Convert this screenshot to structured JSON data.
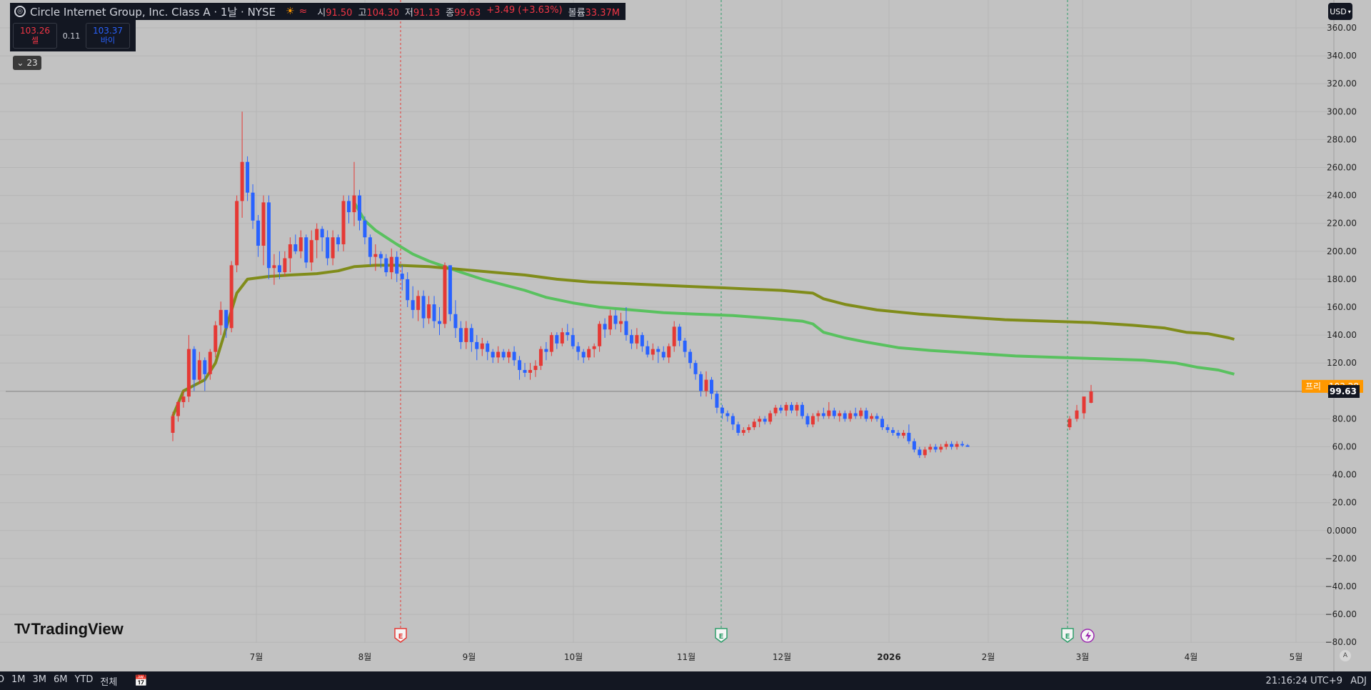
{
  "header": {
    "title": "Circle Internet Group, Inc. Class A · 1날 · NYSE",
    "logo_icon": "circle-logo-icon",
    "ohlc": {
      "open_label": "시",
      "open": "91.50",
      "high_label": "고",
      "high": "104.30",
      "low_label": "저",
      "low": "91.13",
      "close_label": "종",
      "close": "99.63",
      "change": "+3.49 (+3.63%)",
      "volume_label": "볼륨",
      "volume": "33.37M"
    }
  },
  "trade": {
    "sell_price": "103.26",
    "sell_label": "셀",
    "spread": "0.11",
    "buy_price": "103.37",
    "buy_label": "바이"
  },
  "indicators_toggle": {
    "count": "23"
  },
  "currency": "USD",
  "brand": "TradingView",
  "bottom_bar": {
    "ranges": [
      "D",
      "1M",
      "3M",
      "6M",
      "YTD",
      "전체"
    ],
    "clock": "21:16:24 UTC+9",
    "adj": "ADJ"
  },
  "auto_scale_label": "A",
  "colors": {
    "up": "#e53935",
    "down": "#2962ff",
    "ma_fast": "#59c15f",
    "ma_slow": "#808c1a",
    "background": "#c2c2c2",
    "price_tag_orange": "#ff9800"
  },
  "chart_data": {
    "type": "candlestick",
    "symbol": "Circle Internet Group, Inc. Class A",
    "interval": "1날",
    "exchange": "NYSE",
    "y_axis_ticks": [
      "360.00",
      "340.00",
      "320.00",
      "300.00",
      "280.00",
      "260.00",
      "240.00",
      "220.00",
      "200.00",
      "180.00",
      "160.00",
      "140.00",
      "120.00",
      "100.00",
      "80.00",
      "60.00",
      "40.00",
      "20.00",
      "0.0000",
      "−20.00",
      "−40.00",
      "−60.00",
      "−80.00"
    ],
    "ylim": [
      -80,
      360
    ],
    "x_axis_labels": [
      "7월",
      "8월",
      "9월",
      "10월",
      "11월",
      "12월",
      "2026",
      "2월",
      "3월",
      "4월",
      "5월"
    ],
    "last_price": "99.63",
    "pre_market": {
      "label": "프리",
      "price": "103.28"
    },
    "earnings_markers": [
      "E",
      "E",
      "E"
    ],
    "candles": [
      [
        70,
        85,
        64,
        82
      ],
      [
        82,
        93,
        78,
        92
      ],
      [
        92,
        100,
        88,
        96
      ],
      [
        96,
        140,
        92,
        130
      ],
      [
        130,
        132,
        100,
        108
      ],
      [
        108,
        128,
        105,
        122
      ],
      [
        122,
        124,
        100,
        112
      ],
      [
        112,
        130,
        108,
        128
      ],
      [
        128,
        150,
        124,
        147
      ],
      [
        147,
        164,
        140,
        158
      ],
      [
        158,
        158,
        138,
        145
      ],
      [
        145,
        193,
        142,
        190
      ],
      [
        190,
        240,
        185,
        236
      ],
      [
        236,
        300,
        224,
        264
      ],
      [
        264,
        268,
        236,
        242
      ],
      [
        242,
        248,
        216,
        222
      ],
      [
        222,
        226,
        196,
        204
      ],
      [
        204,
        240,
        190,
        235
      ],
      [
        235,
        240,
        180,
        188
      ],
      [
        188,
        198,
        176,
        190
      ],
      [
        190,
        200,
        180,
        185
      ],
      [
        185,
        200,
        182,
        195
      ],
      [
        195,
        210,
        185,
        205
      ],
      [
        205,
        212,
        198,
        200
      ],
      [
        200,
        215,
        195,
        210
      ],
      [
        210,
        212,
        188,
        192
      ],
      [
        192,
        215,
        186,
        208
      ],
      [
        208,
        220,
        195,
        216
      ],
      [
        216,
        218,
        200,
        210
      ],
      [
        210,
        215,
        190,
        195
      ],
      [
        195,
        215,
        190,
        210
      ],
      [
        210,
        212,
        200,
        205
      ],
      [
        205,
        240,
        200,
        236
      ],
      [
        236,
        240,
        220,
        228
      ],
      [
        228,
        264,
        218,
        240
      ],
      [
        240,
        244,
        215,
        222
      ],
      [
        222,
        225,
        205,
        210
      ],
      [
        210,
        212,
        190,
        196
      ],
      [
        196,
        205,
        186,
        198
      ],
      [
        198,
        200,
        188,
        195
      ],
      [
        195,
        198,
        182,
        185
      ],
      [
        185,
        202,
        180,
        196
      ],
      [
        196,
        200,
        178,
        184
      ],
      [
        184,
        190,
        172,
        180
      ],
      [
        180,
        185,
        160,
        165
      ],
      [
        165,
        175,
        152,
        158
      ],
      [
        158,
        172,
        150,
        168
      ],
      [
        168,
        172,
        145,
        152
      ],
      [
        152,
        168,
        148,
        162
      ],
      [
        162,
        168,
        145,
        150
      ],
      [
        150,
        160,
        140,
        148
      ],
      [
        148,
        192,
        145,
        190
      ],
      [
        190,
        190,
        150,
        155
      ],
      [
        155,
        165,
        138,
        145
      ],
      [
        145,
        150,
        130,
        135
      ],
      [
        135,
        150,
        130,
        145
      ],
      [
        145,
        148,
        128,
        135
      ],
      [
        135,
        140,
        122,
        130
      ],
      [
        130,
        138,
        125,
        134
      ],
      [
        134,
        136,
        122,
        128
      ],
      [
        128,
        130,
        120,
        124
      ],
      [
        124,
        132,
        120,
        128
      ],
      [
        128,
        130,
        122,
        124
      ],
      [
        124,
        130,
        120,
        128
      ],
      [
        128,
        132,
        118,
        122
      ],
      [
        122,
        125,
        108,
        115
      ],
      [
        115,
        120,
        110,
        113
      ],
      [
        113,
        120,
        108,
        115
      ],
      [
        115,
        122,
        110,
        118
      ],
      [
        118,
        132,
        115,
        130
      ],
      [
        130,
        135,
        122,
        128
      ],
      [
        128,
        142,
        125,
        140
      ],
      [
        140,
        142,
        130,
        134
      ],
      [
        134,
        145,
        132,
        142
      ],
      [
        142,
        148,
        136,
        140
      ],
      [
        140,
        145,
        130,
        132
      ],
      [
        132,
        135,
        122,
        128
      ],
      [
        128,
        130,
        120,
        124
      ],
      [
        124,
        132,
        122,
        130
      ],
      [
        130,
        134,
        124,
        132
      ],
      [
        132,
        150,
        128,
        148
      ],
      [
        148,
        152,
        138,
        144
      ],
      [
        144,
        158,
        140,
        154
      ],
      [
        154,
        158,
        144,
        148
      ],
      [
        148,
        156,
        142,
        150
      ],
      [
        150,
        160,
        136,
        140
      ],
      [
        140,
        144,
        130,
        134
      ],
      [
        134,
        145,
        130,
        140
      ],
      [
        140,
        142,
        128,
        132
      ],
      [
        132,
        136,
        124,
        126
      ],
      [
        126,
        134,
        122,
        130
      ],
      [
        130,
        132,
        120,
        128
      ],
      [
        128,
        132,
        122,
        124
      ],
      [
        124,
        134,
        120,
        132
      ],
      [
        132,
        150,
        128,
        146
      ],
      [
        146,
        148,
        132,
        136
      ],
      [
        136,
        138,
        124,
        128
      ],
      [
        128,
        130,
        116,
        120
      ],
      [
        120,
        122,
        108,
        112
      ],
      [
        112,
        114,
        96,
        100
      ],
      [
        100,
        114,
        96,
        108
      ],
      [
        108,
        110,
        94,
        98
      ],
      [
        98,
        100,
        84,
        88
      ],
      [
        88,
        90,
        80,
        84
      ],
      [
        84,
        86,
        78,
        82
      ],
      [
        82,
        84,
        72,
        76
      ],
      [
        76,
        78,
        68,
        70
      ],
      [
        70,
        74,
        68,
        72
      ],
      [
        72,
        76,
        70,
        74
      ],
      [
        74,
        80,
        72,
        78
      ],
      [
        78,
        82,
        74,
        80
      ],
      [
        80,
        82,
        76,
        78
      ],
      [
        78,
        86,
        76,
        84
      ],
      [
        84,
        90,
        82,
        88
      ],
      [
        88,
        90,
        84,
        86
      ],
      [
        86,
        92,
        82,
        90
      ],
      [
        90,
        92,
        84,
        86
      ],
      [
        86,
        92,
        82,
        90
      ],
      [
        90,
        92,
        80,
        82
      ],
      [
        82,
        84,
        74,
        76
      ],
      [
        76,
        84,
        74,
        82
      ],
      [
        82,
        86,
        78,
        84
      ],
      [
        84,
        88,
        80,
        82
      ],
      [
        82,
        92,
        80,
        86
      ],
      [
        86,
        88,
        80,
        82
      ],
      [
        82,
        86,
        78,
        84
      ],
      [
        84,
        86,
        78,
        80
      ],
      [
        80,
        86,
        78,
        84
      ],
      [
        84,
        88,
        80,
        82
      ],
      [
        82,
        88,
        80,
        86
      ],
      [
        86,
        88,
        78,
        80
      ],
      [
        80,
        84,
        78,
        82
      ],
      [
        82,
        84,
        78,
        80
      ],
      [
        80,
        82,
        72,
        74
      ],
      [
        74,
        76,
        70,
        72
      ],
      [
        72,
        74,
        68,
        70
      ],
      [
        70,
        72,
        66,
        68
      ],
      [
        68,
        72,
        66,
        70
      ],
      [
        70,
        76,
        62,
        64
      ],
      [
        64,
        66,
        56,
        58
      ],
      [
        58,
        60,
        52,
        54
      ],
      [
        54,
        60,
        52,
        58
      ],
      [
        58,
        62,
        56,
        60
      ],
      [
        60,
        62,
        56,
        58
      ],
      [
        58,
        62,
        56,
        60
      ],
      [
        60,
        64,
        58,
        62
      ],
      [
        62,
        64,
        58,
        60
      ],
      [
        60,
        64,
        58,
        62
      ],
      [
        62,
        64,
        60,
        61
      ],
      [
        61,
        62,
        60,
        60
      ],
      [
        74,
        82,
        72,
        80
      ],
      [
        80,
        90,
        78,
        86
      ],
      [
        84,
        92,
        80,
        96
      ],
      [
        91.5,
        104.3,
        91.13,
        99.63
      ]
    ],
    "series": [
      {
        "name": "",
        "color": "#59c15f",
        "points": [
          [
            34,
            235
          ],
          [
            36,
            222
          ],
          [
            38,
            215
          ],
          [
            40,
            210
          ],
          [
            42,
            205
          ],
          [
            45,
            198
          ],
          [
            48,
            193
          ],
          [
            51,
            189
          ],
          [
            54,
            185
          ],
          [
            58,
            180
          ],
          [
            62,
            176
          ],
          [
            66,
            172
          ],
          [
            70,
            167
          ],
          [
            75,
            163
          ],
          [
            80,
            160
          ],
          [
            86,
            158
          ],
          [
            92,
            156
          ],
          [
            98,
            155
          ],
          [
            105,
            154
          ],
          [
            112,
            152
          ],
          [
            118,
            150
          ],
          [
            120,
            148
          ],
          [
            122,
            142
          ],
          [
            126,
            138
          ],
          [
            130,
            135
          ],
          [
            136,
            131
          ],
          [
            142,
            129
          ],
          [
            150,
            127
          ],
          [
            158,
            125
          ],
          [
            166,
            124
          ],
          [
            174,
            123
          ],
          [
            182,
            122
          ],
          [
            188,
            120
          ],
          [
            192,
            117
          ],
          [
            196,
            115
          ],
          [
            198,
            113
          ],
          [
            199,
            112
          ]
        ]
      },
      {
        "name": "",
        "color": "#808c1a",
        "points": [
          [
            0,
            82
          ],
          [
            2,
            100
          ],
          [
            4,
            104
          ],
          [
            6,
            108
          ],
          [
            8,
            120
          ],
          [
            10,
            145
          ],
          [
            12,
            170
          ],
          [
            14,
            180
          ],
          [
            18,
            182
          ],
          [
            22,
            183
          ],
          [
            27,
            184
          ],
          [
            31,
            186
          ],
          [
            34,
            189
          ],
          [
            38,
            190
          ],
          [
            42,
            190
          ],
          [
            48,
            189
          ],
          [
            54,
            187
          ],
          [
            60,
            185
          ],
          [
            66,
            183
          ],
          [
            72,
            180
          ],
          [
            78,
            178
          ],
          [
            84,
            177
          ],
          [
            90,
            176
          ],
          [
            96,
            175
          ],
          [
            102,
            174
          ],
          [
            108,
            173
          ],
          [
            114,
            172
          ],
          [
            120,
            170
          ],
          [
            122,
            166
          ],
          [
            126,
            162
          ],
          [
            132,
            158
          ],
          [
            140,
            155
          ],
          [
            148,
            153
          ],
          [
            156,
            151
          ],
          [
            164,
            150
          ],
          [
            172,
            149
          ],
          [
            180,
            147
          ],
          [
            186,
            145
          ],
          [
            190,
            142
          ],
          [
            194,
            141
          ],
          [
            198,
            138
          ],
          [
            199,
            137
          ]
        ]
      }
    ]
  }
}
